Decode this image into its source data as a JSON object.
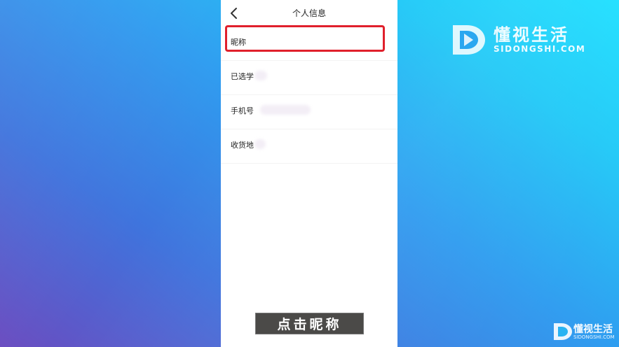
{
  "header": {
    "title": "个人信息",
    "back_icon": "chevron-left-icon"
  },
  "rows": [
    {
      "label": "昵称"
    },
    {
      "label": "已选学"
    },
    {
      "label": "手机号"
    },
    {
      "label": "收货地"
    }
  ],
  "caption": {
    "text": "点击昵称"
  },
  "watermark": {
    "brand": "懂视生活",
    "domain": "SIDONGSHI.COM",
    "small_brand": "懂视生活",
    "small_domain": "SIDONGSHI.COM"
  },
  "colors": {
    "highlight": "#e0202c",
    "caption_bg": "#4b4a48"
  }
}
